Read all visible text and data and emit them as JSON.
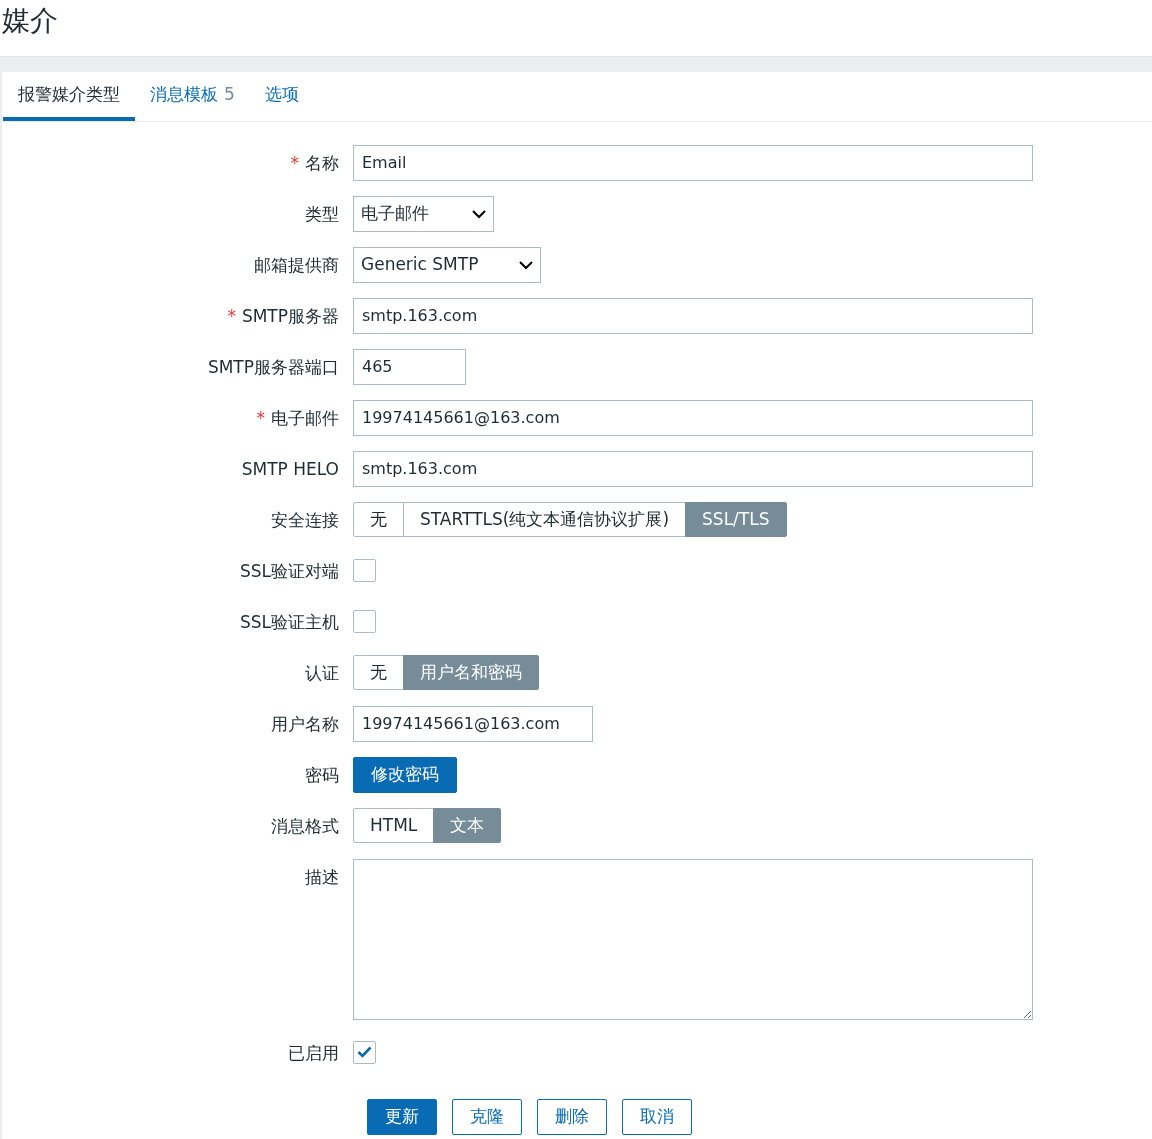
{
  "title": "媒介",
  "tabs": [
    {
      "label": "报警媒介类型",
      "selected": true
    },
    {
      "label": "消息模板",
      "count": "5",
      "selected": false
    },
    {
      "label": "选项",
      "selected": false
    }
  ],
  "fields": [
    {
      "kind": "text",
      "label": "名称",
      "marker": "*",
      "value": "Email"
    },
    {
      "kind": "select",
      "label": "类型",
      "value": "电子邮件"
    },
    {
      "kind": "select",
      "label": "邮箱提供商",
      "value": "Generic SMTP"
    },
    {
      "kind": "text",
      "label": "SMTP服务器",
      "marker": "*",
      "value": "smtp.163.com"
    },
    {
      "kind": "text",
      "label": "SMTP服务器端口",
      "value": "465"
    },
    {
      "kind": "text",
      "label": "电子邮件",
      "marker": "*",
      "value": "19974145661@163.com"
    },
    {
      "kind": "text",
      "label": "SMTP HELO",
      "value": "smtp.163.com"
    },
    {
      "kind": "segmented",
      "label": "安全连接",
      "options": [
        {
          "label": "无",
          "selected": false
        },
        {
          "label": "STARTTLS(纯文本通信协议扩展)",
          "selected": false
        },
        {
          "label": "SSL/TLS",
          "selected": true
        }
      ]
    },
    {
      "kind": "checkbox",
      "label": "SSL验证对端",
      "checked": false
    },
    {
      "kind": "checkbox",
      "label": "SSL验证主机",
      "checked": false
    },
    {
      "kind": "segmented",
      "label": "认证",
      "options": [
        {
          "label": "无",
          "selected": false
        },
        {
          "label": "用户名和密码",
          "selected": true
        }
      ]
    },
    {
      "kind": "text",
      "label": "用户名称",
      "value": "19974145661@163.com"
    },
    {
      "kind": "button",
      "label": "密码",
      "button": "修改密码"
    },
    {
      "kind": "segmented",
      "label": "消息格式",
      "options": [
        {
          "label": "HTML",
          "selected": false
        },
        {
          "label": "文本",
          "selected": true
        }
      ]
    },
    {
      "kind": "textarea",
      "label": "描述"
    },
    {
      "kind": "checkbox",
      "label": "已启用",
      "checked": true
    }
  ],
  "actions": [
    {
      "label": "更新",
      "primary": true
    },
    {
      "label": "克隆",
      "primary": false
    },
    {
      "label": "删除",
      "primary": false
    },
    {
      "label": "取消",
      "primary": false
    }
  ]
}
